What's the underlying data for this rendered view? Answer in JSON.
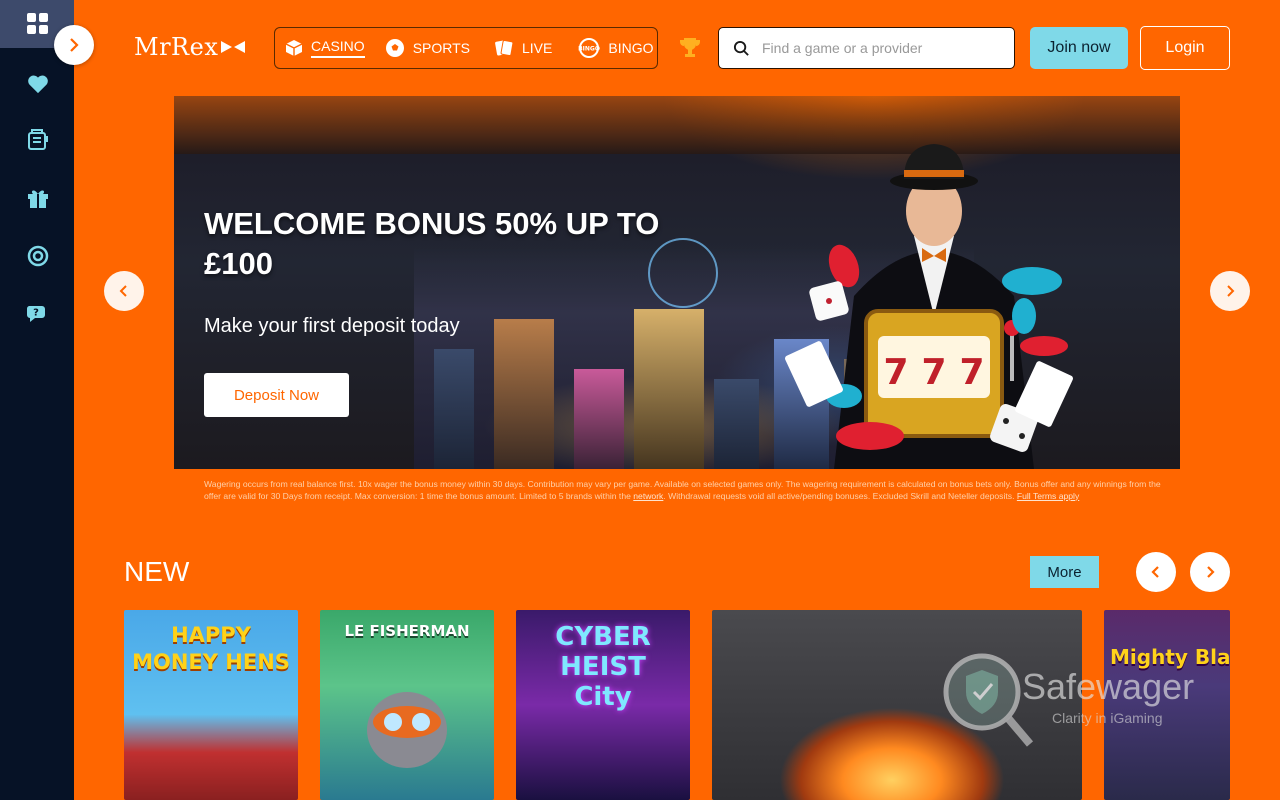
{
  "header": {
    "logo_text": "MrRex",
    "nav": [
      {
        "label": "CASINO",
        "icon": "cube-icon",
        "active": true
      },
      {
        "label": "SPORTS",
        "icon": "soccer-ball-icon",
        "active": false
      },
      {
        "label": "LIVE",
        "icon": "cards-icon",
        "active": false
      },
      {
        "label": "BINGO",
        "icon": "bingo-icon",
        "active": false
      }
    ],
    "search_placeholder": "Find a game or a provider",
    "join_label": "Join now",
    "login_label": "Login"
  },
  "banner": {
    "title": "WELCOME BONUS 50% UP TO £100",
    "subtitle": "Make your first deposit today",
    "cta_label": "Deposit Now"
  },
  "terms": {
    "text": "Wagering occurs from real balance first. 10x wager the bonus money within 30 days. Contribution may vary per game. Available on selected games only. The wagering requirement is calculated on bonus bets only. Bonus offer and any winnings from the offer are valid for 30 Days from receipt. Max conversion: 1 time the bonus amount. Limited to 5 brands within the ",
    "network_link": "network",
    "text2": ". Withdrawal requests void all active/pending bonuses. Excluded Skrill and Neteller deposits. ",
    "full_terms_link": "Full Terms apply"
  },
  "new_section": {
    "title": "NEW",
    "more_label": "More",
    "games": [
      {
        "title": "HAPPY MONEY HENS"
      },
      {
        "title": "LE FISHERMAN"
      },
      {
        "title": "CYBER HEIST City"
      },
      {
        "title": ""
      },
      {
        "title": "Mighty Black Knight"
      }
    ]
  },
  "watermark": {
    "name": "Safewager",
    "tagline": "Clarity in iGaming"
  },
  "colors": {
    "brand_orange": "#ff6600",
    "sidebar_bg": "#061226",
    "accent_cyan": "#7fd9e8"
  }
}
